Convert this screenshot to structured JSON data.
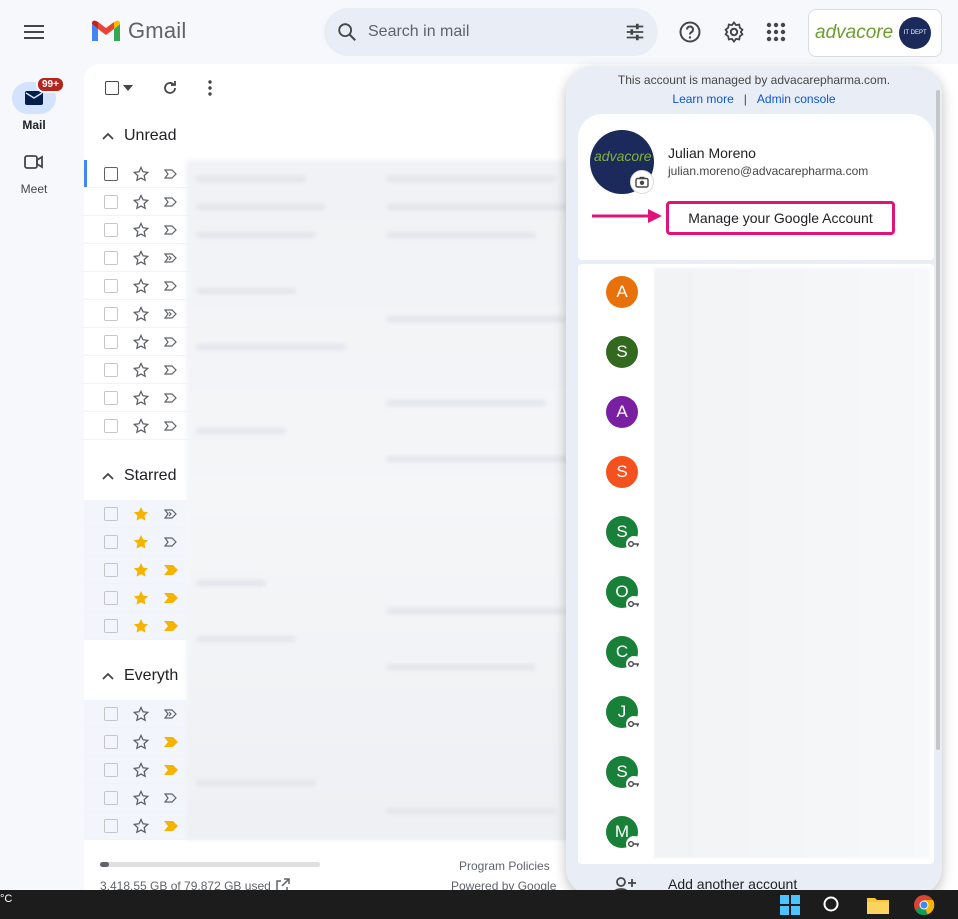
{
  "app": {
    "name": "Gmail",
    "search_placeholder": "Search in mail"
  },
  "rail": {
    "mail_label": "Mail",
    "mail_badge": "99+",
    "meet_label": "Meet"
  },
  "sections": {
    "unread": "Unread",
    "starred": "Starred",
    "everything": "Everyth"
  },
  "footer": {
    "storage": "3,418.55 GB of 79,872 GB used",
    "storage_used_fraction": 0.043,
    "program_policies": "Program Policies",
    "powered_by": "Powered by Google"
  },
  "account_menu": {
    "managed_notice": "This account is managed by advacarepharma.com.",
    "learn_more": "Learn more",
    "separator": "|",
    "admin_console": "Admin console",
    "user_name": "Julian Moreno",
    "user_email": "julian.moreno@advacarepharma.com",
    "manage_button": "Manage your Google Account",
    "add_account": "Add another account",
    "accounts": [
      {
        "initial": "A",
        "color": "#e8710a",
        "managed": false
      },
      {
        "initial": "S",
        "color": "#33691e",
        "managed": false
      },
      {
        "initial": "A",
        "color": "#7b1fa2",
        "managed": false
      },
      {
        "initial": "S",
        "color": "#f4511e",
        "managed": false
      },
      {
        "initial": "S",
        "color": "#188038",
        "managed": true
      },
      {
        "initial": "O",
        "color": "#188038",
        "managed": true
      },
      {
        "initial": "C",
        "color": "#188038",
        "managed": true
      },
      {
        "initial": "J",
        "color": "#188038",
        "managed": true
      },
      {
        "initial": "S",
        "color": "#188038",
        "managed": true
      },
      {
        "initial": "M",
        "color": "#188038",
        "managed": true
      }
    ]
  },
  "brand": {
    "word_a": "advacore",
    "logo_small_text": "IT DEPT"
  },
  "taskbar": {
    "temperature": "°C"
  },
  "colors": {
    "accent": "#0b57d0",
    "highlight_border": "#e0137a",
    "star": "#f4b400",
    "important": "#f4b400"
  }
}
